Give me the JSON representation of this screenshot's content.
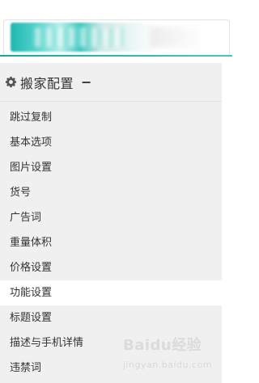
{
  "header": {
    "logo_blurred": true
  },
  "sidebar": {
    "section_title": "搬家配置",
    "collapse_symbol": "−",
    "items": [
      {
        "label": "跳过复制"
      },
      {
        "label": "基本选项"
      },
      {
        "label": "图片设置"
      },
      {
        "label": "货号"
      },
      {
        "label": "广告词"
      },
      {
        "label": "重量体积"
      },
      {
        "label": "价格设置"
      },
      {
        "label": "功能设置",
        "active": true
      },
      {
        "label": "标题设置"
      },
      {
        "label": "描述与手机详情"
      },
      {
        "label": "违禁词"
      }
    ]
  },
  "watermark": {
    "text": "Baidu经验",
    "sub": "jingyan.baidu.com"
  },
  "colors": {
    "accent": "#1aa69f",
    "sidebar_bg": "#f0f0f0",
    "active_bg": "#ffffff",
    "text": "#333333"
  },
  "icons": {
    "section": "gear-icon"
  }
}
